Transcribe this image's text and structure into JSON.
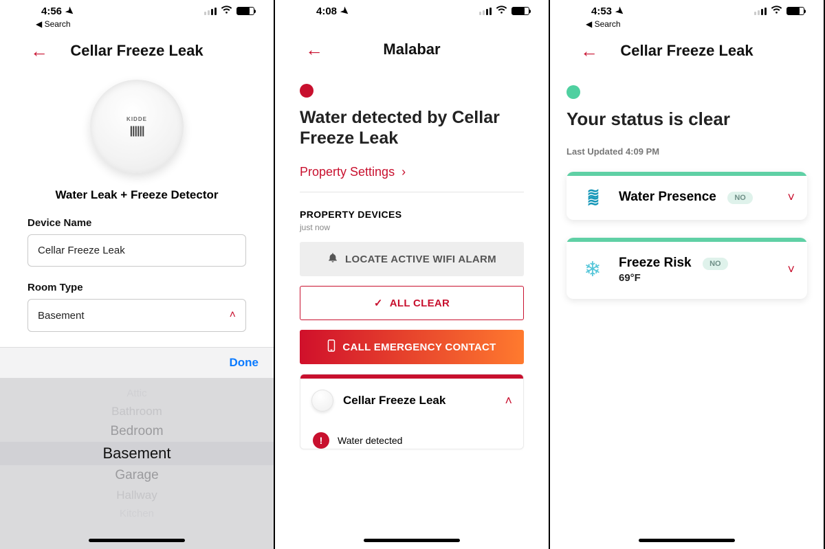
{
  "panel1": {
    "status_time": "4:56",
    "back_search": "Search",
    "nav_title": "Cellar Freeze Leak",
    "device_brand": "KIDDE",
    "device_subtitle": "Water Leak + Freeze Detector",
    "field_device_name_label": "Device Name",
    "field_device_name_value": "Cellar Freeze Leak",
    "field_room_type_label": "Room Type",
    "field_room_type_value": "Basement",
    "picker_done": "Done",
    "picker_options": {
      "o0": "Attic",
      "o1": "Bathroom",
      "o2": "Bedroom",
      "o3": "Basement",
      "o4": "Garage",
      "o5": "Hallway",
      "o6": "Kitchen"
    }
  },
  "panel2": {
    "status_time": "4:08",
    "nav_title": "Malabar",
    "headline": "Water detected by Cellar Freeze Leak",
    "link_property_settings": "Property Settings",
    "section_devices": "PROPERTY DEVICES",
    "section_updated": "just now",
    "btn_locate": "LOCATE ACTIVE WIFI ALARM",
    "btn_all_clear": "ALL CLEAR",
    "btn_emergency": "CALL EMERGENCY CONTACT",
    "card_title": "Cellar Freeze Leak",
    "card_status": "Water detected"
  },
  "panel3": {
    "status_time": "4:53",
    "back_search": "Search",
    "nav_title": "Cellar Freeze Leak",
    "headline": "Your status is clear",
    "last_updated": "Last Updated 4:09 PM",
    "card_water_title": "Water Presence",
    "card_water_badge": "NO",
    "card_freeze_title": "Freeze Risk",
    "card_freeze_badge": "NO",
    "card_freeze_temp": "69°F"
  }
}
